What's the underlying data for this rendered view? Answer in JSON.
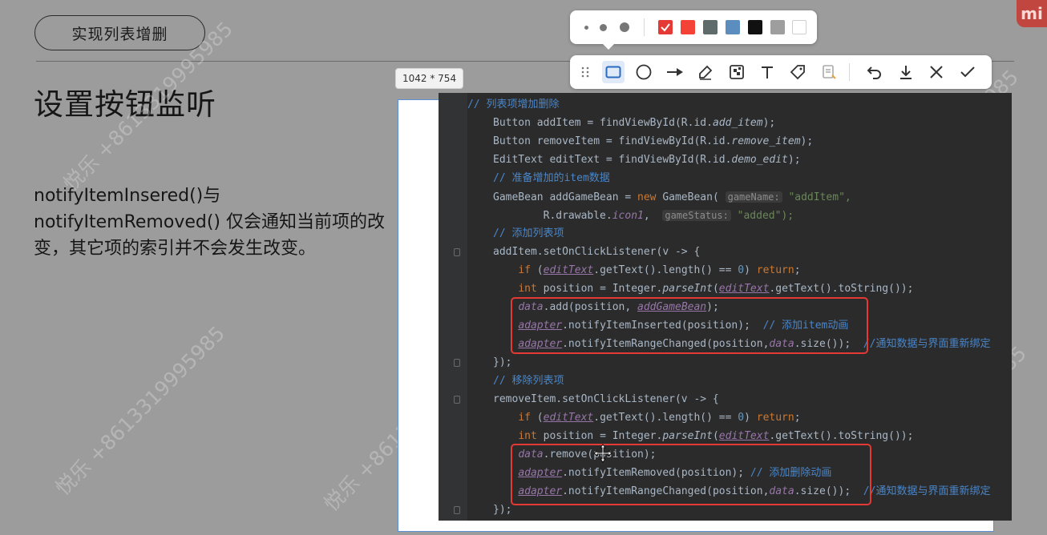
{
  "slide": {
    "topic": "实现列表增删",
    "heading": "设置按钮监听",
    "description": "notifyItemInsered()与notifyItemRemoved() 仅会通知当前项的改变，其它项的索引并不会发生改变。",
    "watermark": "悦乐 +8613319995985"
  },
  "capture": {
    "size_label": "1042 * 754"
  },
  "toolbar": {
    "colors": [
      "#e53935",
      "#f44336",
      "#5f6b6b",
      "#5b8dbe",
      "#111111",
      "#9e9e9e",
      "#ffffff"
    ],
    "selected_color": "#e53935",
    "brush_sizes": [
      "small",
      "medium",
      "large"
    ],
    "tools": [
      "drag-handle-icon",
      "rectangle-icon",
      "circle-icon",
      "arrow-icon",
      "pen-icon",
      "mosaic-icon",
      "text-icon",
      "tag-icon",
      "ocr-icon",
      "undo-icon",
      "download-icon",
      "close-icon",
      "confirm-icon"
    ],
    "active_tool": "rectangle-icon"
  },
  "code": {
    "l1": "// 列表项增加删除",
    "l2a": "Button addItem = findViewById(R.id.",
    "l2b": "add_item",
    "l2c": ");",
    "l3a": "Button removeItem = findViewById(R.id.",
    "l3b": "remove_item",
    "l3c": ");",
    "l4a": "EditText editText = findViewById(R.id.",
    "l4b": "demo_edit",
    "l4c": ");",
    "l5": "// 准备增加的item数据",
    "l6a": "GameBean addGameBean = ",
    "l6b": "new",
    "l6c": " GameBean( ",
    "l6d": "gameName:",
    "l6e": " \"addItem\",",
    "l7a": "        R.drawable.",
    "l7b": "icon1",
    "l7c": ",  ",
    "l7d": "gameStatus:",
    "l7e": " \"added\");",
    "l8": "// 添加列表项",
    "l9a": "addItem.setOnClickListener(v -> {",
    "l10a": "    ",
    "l10b": "if",
    "l10c": " (",
    "l10d": "editText",
    "l10e": ".getText().length() == ",
    "l10f": "0",
    "l10g": ") ",
    "l10h": "return",
    "l10i": ";",
    "l11a": "    ",
    "l11b": "int",
    "l11c": " position = Integer.",
    "l11d": "parseInt",
    "l11e": "(",
    "l11f": "editText",
    "l11g": ".getText().toString());",
    "l12a": "    ",
    "l12b": "data",
    "l12c": ".add(position, ",
    "l12d": "addGameBean",
    "l12e": ");",
    "l13a": "    ",
    "l13b": "adapter",
    "l13c": ".notifyItemInserted(position);  ",
    "l13d": "// 添加item动画",
    "l14a": "    ",
    "l14b": "adapter",
    "l14c": ".notifyItemRangeChanged(position,",
    "l14d": "data",
    "l14e": ".size());  ",
    "l14f": "//通知数据与界面重新绑定",
    "l15": "});",
    "l16": "// 移除列表项",
    "l17": "removeItem.setOnClickListener(v -> {",
    "l18a": "    ",
    "l18b": "if",
    "l18c": " (",
    "l18d": "editText",
    "l18e": ".getText().length() == ",
    "l18f": "0",
    "l18g": ") ",
    "l18h": "return",
    "l18i": ";",
    "l19a": "    ",
    "l19b": "int",
    "l19c": " position = Integer.",
    "l19d": "parseInt",
    "l19e": "(",
    "l19f": "editText",
    "l19g": ".getText().toString());",
    "l20a": "    ",
    "l20b": "data",
    "l20c": ".remove(position);",
    "l21a": "    ",
    "l21b": "adapter",
    "l21c": ".notifyItemRemoved(position); ",
    "l21d": "// 添加删除动画",
    "l22a": "    ",
    "l22b": "adapter",
    "l22c": ".notifyItemRangeChanged(position,",
    "l22d": "data",
    "l22e": ".size());  ",
    "l22f": "//通知数据与界面重新绑定",
    "l23": "});"
  }
}
